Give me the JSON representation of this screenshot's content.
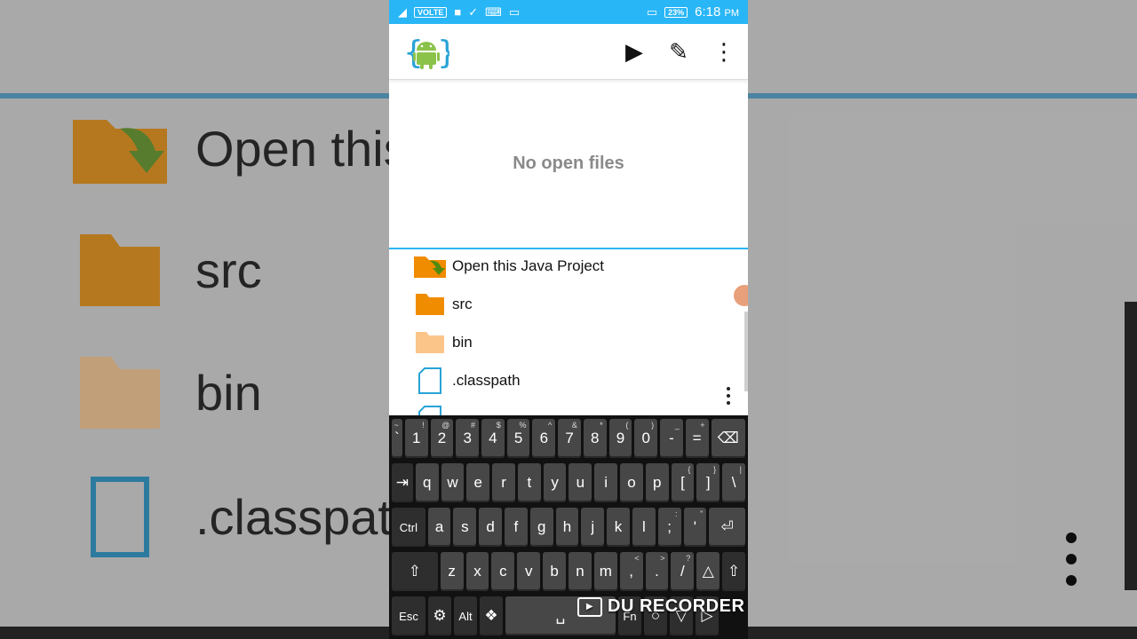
{
  "status": {
    "network": "VOLTE",
    "battery": "23%",
    "time": "6:18",
    "ampm": "PM"
  },
  "toolbar": {
    "logo": "android-logo",
    "run_icon": "▶",
    "edit_icon": "✎",
    "more_icon": "⋮"
  },
  "editor": {
    "empty_message": "No open files"
  },
  "tree": {
    "items": [
      {
        "label": "Open this Java Project"
      },
      {
        "label": "src"
      },
      {
        "label": "bin"
      },
      {
        "label": ".classpath"
      }
    ]
  },
  "keyboard": {
    "row1": [
      {
        "main": "`",
        "alt": "~"
      },
      {
        "main": "1",
        "alt": "!"
      },
      {
        "main": "2",
        "alt": "@"
      },
      {
        "main": "3",
        "alt": "#"
      },
      {
        "main": "4",
        "alt": "$"
      },
      {
        "main": "5",
        "alt": "%"
      },
      {
        "main": "6",
        "alt": "^"
      },
      {
        "main": "7",
        "alt": "&"
      },
      {
        "main": "8",
        "alt": "*"
      },
      {
        "main": "9",
        "alt": "("
      },
      {
        "main": "0",
        "alt": ")"
      },
      {
        "main": "-",
        "alt": "_"
      },
      {
        "main": "=",
        "alt": "+"
      }
    ],
    "row2": [
      {
        "main": "q"
      },
      {
        "main": "w"
      },
      {
        "main": "e"
      },
      {
        "main": "r"
      },
      {
        "main": "t"
      },
      {
        "main": "y"
      },
      {
        "main": "u"
      },
      {
        "main": "i"
      },
      {
        "main": "o"
      },
      {
        "main": "p"
      },
      {
        "main": "[",
        "alt": "{"
      },
      {
        "main": "]",
        "alt": "}"
      },
      {
        "main": "\\",
        "alt": "|"
      }
    ],
    "row3": [
      {
        "main": "Ctrl"
      },
      {
        "main": "a"
      },
      {
        "main": "s"
      },
      {
        "main": "d"
      },
      {
        "main": "f"
      },
      {
        "main": "g"
      },
      {
        "main": "h"
      },
      {
        "main": "j"
      },
      {
        "main": "k"
      },
      {
        "main": "l"
      },
      {
        "main": ";",
        "alt": ":"
      },
      {
        "main": "'",
        "alt": "\""
      }
    ],
    "row4": [
      {
        "main": "z"
      },
      {
        "main": "x"
      },
      {
        "main": "c"
      },
      {
        "main": "v"
      },
      {
        "main": "b"
      },
      {
        "main": "n"
      },
      {
        "main": "m"
      },
      {
        "main": ",",
        "alt": "<"
      },
      {
        "main": ".",
        "alt": ">"
      },
      {
        "main": "/",
        "alt": "?"
      },
      {
        "main": "△"
      }
    ],
    "row5": {
      "esc": "Esc",
      "alt": "Alt",
      "fn": "Fn"
    }
  },
  "watermark": "DU RECORDER",
  "background": {
    "labels": [
      "Open this",
      "src",
      "bin",
      ".classpat"
    ]
  }
}
